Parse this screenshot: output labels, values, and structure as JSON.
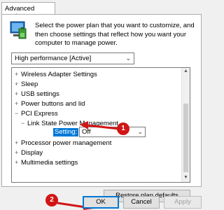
{
  "tab": "Advanced settings",
  "description": "Select the power plan that you want to customize, and then choose settings that reflect how you want your computer to manage power.",
  "plan_select": {
    "value": "High performance [Active]"
  },
  "tree": [
    {
      "label": "Wireless Adapter Settings",
      "expander": "+"
    },
    {
      "label": "Sleep",
      "expander": "+"
    },
    {
      "label": "USB settings",
      "expander": "+"
    },
    {
      "label": "Power buttons and lid",
      "expander": "+"
    },
    {
      "label": "PCI Express",
      "expander": "−"
    },
    {
      "label": "Link State Power Management",
      "expander": "−"
    },
    {
      "label": "Processor power management",
      "expander": "+"
    },
    {
      "label": "Display",
      "expander": "+"
    },
    {
      "label": "Multimedia settings",
      "expander": "+"
    }
  ],
  "setting": {
    "label": "Setting:",
    "value": "Off"
  },
  "buttons": {
    "restore": "Restore plan defaults",
    "ok": "OK",
    "cancel": "Cancel",
    "apply": "Apply"
  },
  "annotations": {
    "step1": "1",
    "step2": "2"
  },
  "colors": {
    "accent": "#0078d7",
    "annotation": "#d11515"
  }
}
